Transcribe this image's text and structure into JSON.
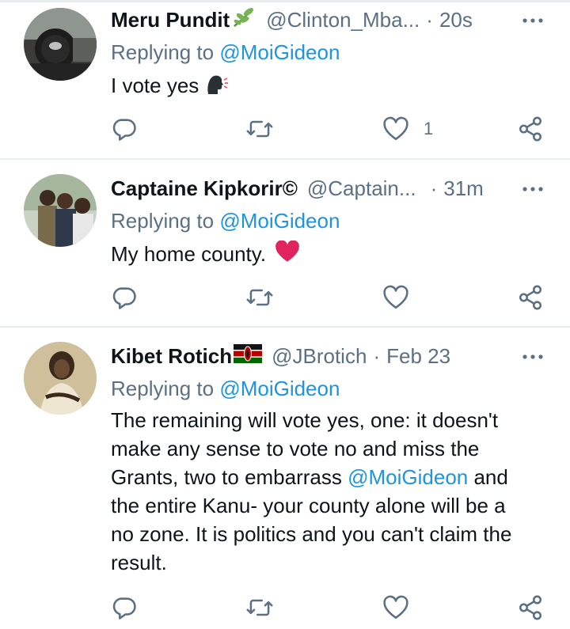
{
  "tweets": [
    {
      "name": "Meru Pundit",
      "name_badge": "seedling-emoji",
      "handle": "@Clinton_Mba...",
      "sep": "·",
      "time": "20s",
      "replying_prefix": "Replying to ",
      "replying_to": "@MoiGideon",
      "text": "I vote yes",
      "text_emoji": "speaking-head-emoji",
      "like_count": "1"
    },
    {
      "name": "Captaine Kipkorir©",
      "handle": "@Captain...",
      "sep": "·",
      "time": "31m",
      "replying_prefix": "Replying to ",
      "replying_to": "@MoiGideon",
      "text": "My home county.",
      "text_emoji": "red-heart-emoji",
      "like_count": ""
    },
    {
      "name": "Kibet Rotich",
      "name_badge": "kenya-flag-emoji",
      "handle": "@JBrotich",
      "sep": "·",
      "time": "Feb 23",
      "replying_prefix": "Replying to ",
      "replying_to": "@MoiGideon",
      "text_lines": [
        "The remaining will vote yes, one: it doesn't",
        "make any sense to vote no and miss the",
        "Grants, two to embarrass ",
        "@MoiGideon",
        " and",
        "the entire Kanu- your county alone will be a",
        "no zone. It is politics and you can't claim the",
        "result."
      ],
      "like_count": ""
    }
  ],
  "icons": {
    "reply": "reply-icon",
    "retweet": "retweet-icon",
    "like": "like-icon",
    "share": "share-icon",
    "more": "more-icon"
  },
  "colors": {
    "secondary_text": "#5b7083",
    "link": "#1b95e0",
    "heart": "#e0245e",
    "divider": "#e6ecf0"
  }
}
